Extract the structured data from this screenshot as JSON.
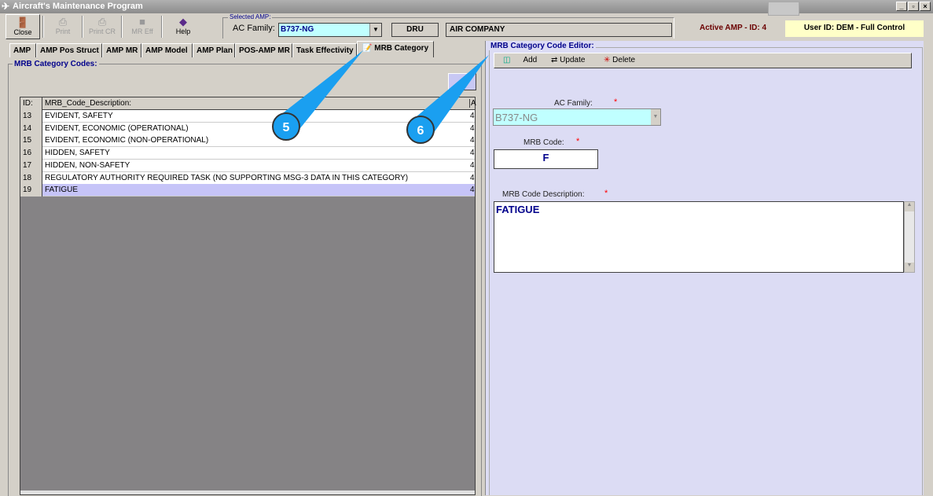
{
  "window": {
    "title": "Aircraft's Maintenance Program"
  },
  "toolbar": {
    "close": "Close",
    "print": "Print",
    "print_cr": "Print CR",
    "mr_eff": "MR Eff",
    "help": "Help"
  },
  "selected_amp": {
    "group_label": "Selected AMP:",
    "ac_family_label": "AC Family:",
    "ac_family_value": "B737-NG",
    "code": "DRU",
    "company": "AIR COMPANY"
  },
  "status": {
    "active_amp": "Active AMP - ID: 4",
    "user": "User ID: DEM - Full Control"
  },
  "tabs": [
    "AMP",
    "AMP Pos Struct",
    "AMP MR",
    "AMP Model",
    "AMP Plan",
    "POS-AMP MR",
    "Task Effectivity",
    "MRB Category"
  ],
  "left": {
    "group_title": "MRB Category Codes:",
    "columns": [
      "ID:",
      "MRB_Code_Description:",
      "A"
    ],
    "rows": [
      {
        "id": "13",
        "desc": "EVIDENT, SAFETY",
        "a": "4"
      },
      {
        "id": "14",
        "desc": "EVIDENT, ECONOMIC (OPERATIONAL)",
        "a": "4"
      },
      {
        "id": "15",
        "desc": "EVIDENT, ECONOMIC (NON-OPERATIONAL)",
        "a": "4"
      },
      {
        "id": "16",
        "desc": "HIDDEN, SAFETY",
        "a": "4"
      },
      {
        "id": "17",
        "desc": "HIDDEN, NON-SAFETY",
        "a": "4"
      },
      {
        "id": "18",
        "desc": "REGULATORY AUTHORITY REQUIRED TASK (NO SUPPORTING MSG-3 DATA IN THIS CATEGORY)",
        "a": "4"
      },
      {
        "id": "19",
        "desc": "FATIGUE",
        "a": "4"
      }
    ]
  },
  "editor": {
    "title": "MRB Category Code Editor:",
    "add": "Add",
    "update": "Update",
    "delete": "Delete",
    "ac_family_label": "AC Family:",
    "ac_family_value": "B737-NG",
    "mrb_code_label": "MRB Code:",
    "mrb_code_value": "F",
    "desc_label": "MRB Code Description:",
    "desc_value": "FATIGUE",
    "required": "*"
  },
  "callouts": [
    "5",
    "6"
  ]
}
